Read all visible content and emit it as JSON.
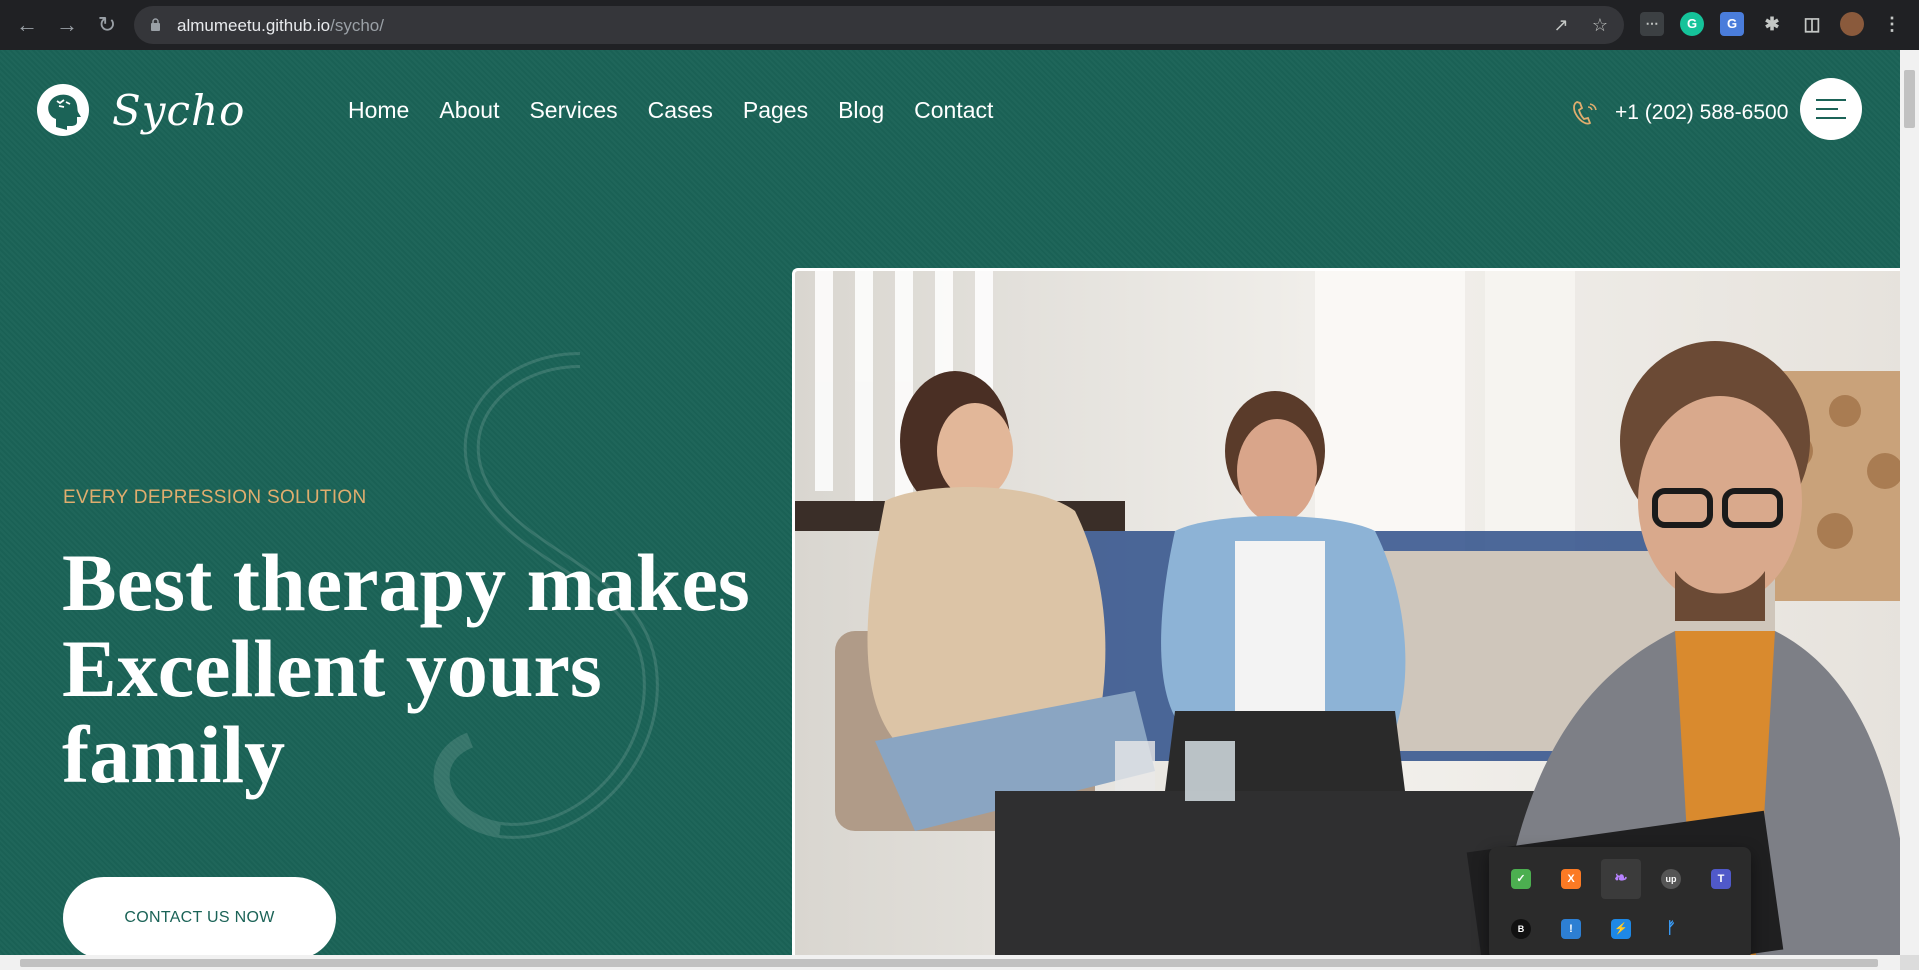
{
  "browser": {
    "url_host": "almumeetu.github.io",
    "url_path": "/sycho/",
    "back_icon": "arrow-left-icon",
    "forward_icon": "arrow-right-icon",
    "reload_icon": "reload-icon"
  },
  "site": {
    "brand": "Sycho",
    "nav": [
      "Home",
      "About",
      "Services",
      "Cases",
      "Pages",
      "Blog",
      "Contact"
    ],
    "phone": "+1 (202) 588-6500"
  },
  "hero": {
    "eyebrow": "EVERY DEPRESSION SOLUTION",
    "headline_1": "Best therapy makes",
    "headline_2": "Excellent yours",
    "headline_3": "family",
    "cta": "CONTACT US NOW",
    "image": "therapy-session-photo"
  },
  "colors": {
    "brand_green": "#1b6357",
    "accent_gold": "#e0ad6e"
  },
  "tray_icons": [
    "shield-check-icon",
    "xampp-icon",
    "feather-icon",
    "upwork-icon",
    "teams-icon",
    "bandcamp-icon",
    "defender-warning-icon",
    "lightning-app-icon",
    "bluetooth-icon"
  ]
}
